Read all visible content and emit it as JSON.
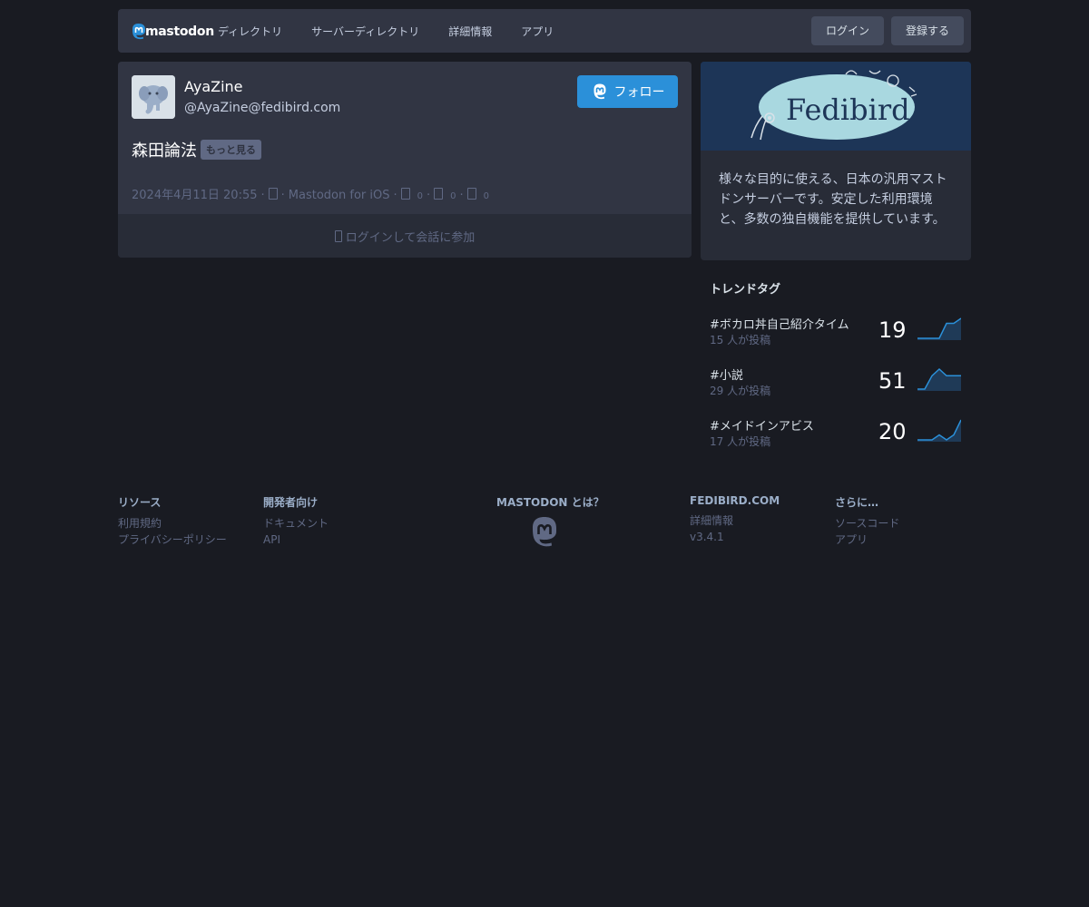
{
  "header": {
    "brand": "mastodon",
    "nav": [
      "ディレクトリ",
      "サーバーディレクトリ",
      "詳細情報",
      "アプリ"
    ],
    "login_label": "ログイン",
    "signup_label": "登録する"
  },
  "post": {
    "display_name": "AyaZine",
    "acct": "@AyaZine@fedibird.com",
    "follow_label": "フォロー",
    "content": "森田論法",
    "more_label": "もっと見る",
    "timestamp": "2024年4月11日 20:55",
    "application": "Mastodon for iOS",
    "replies": "0",
    "boosts": "0",
    "favourites": "0",
    "join_label": "ログインして会話に参加"
  },
  "server": {
    "banner_text": "Fedibird",
    "description": "様々な目的に使える、日本の汎用マストドンサーバーです。安定した利用環境と、多数の独自機能を提供しています。"
  },
  "trends": {
    "title": "トレンドタグ",
    "items": [
      {
        "name": "#ボカロ丼自己紹介タイム",
        "uses": "15 人が投稿",
        "count": "19",
        "history": [
          0,
          0,
          0,
          0,
          3,
          3,
          4
        ]
      },
      {
        "name": "#小説",
        "uses": "29 人が投稿",
        "count": "51",
        "history": [
          0,
          0,
          2,
          3,
          2,
          2,
          2
        ]
      },
      {
        "name": "#メイドインアビス",
        "uses": "17 人が投稿",
        "count": "20",
        "history": [
          0,
          0,
          0,
          1,
          0,
          1,
          4
        ]
      }
    ]
  },
  "footer": {
    "resources": {
      "title": "リソース",
      "links": [
        "利用規約",
        "プライバシーポリシー"
      ]
    },
    "developers": {
      "title": "開発者向け",
      "links": [
        "ドキュメント",
        "API"
      ]
    },
    "about": {
      "title": "MASTODON とは？"
    },
    "instance": {
      "title": "FEDIBIRD.COM",
      "links": [
        "詳細情報",
        "v3.4.1"
      ]
    },
    "more": {
      "title": "さらに…",
      "links": [
        "ソースコード",
        "アプリ"
      ]
    }
  },
  "colors": {
    "background": "#191b22",
    "card": "#313543",
    "accent": "#2b90d9",
    "muted": "#606984"
  }
}
